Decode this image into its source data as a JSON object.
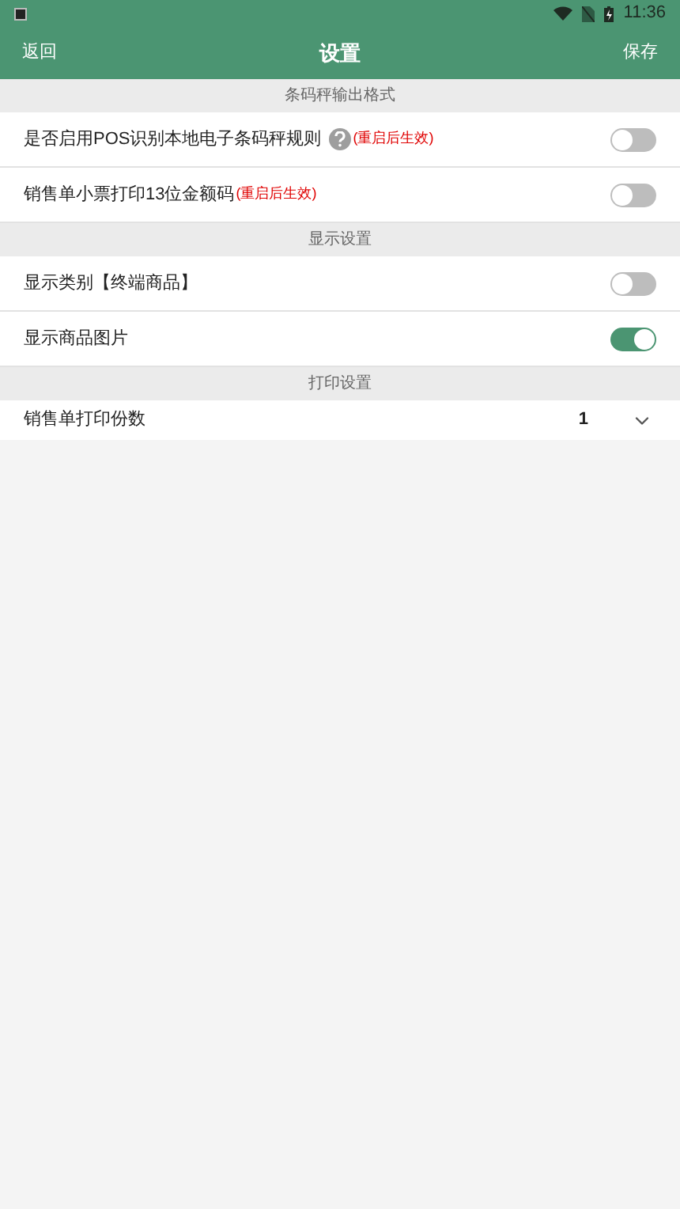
{
  "status_bar": {
    "time": "11:36"
  },
  "header": {
    "back": "返回",
    "title": "设置",
    "save": "保存"
  },
  "sections": [
    {
      "title": "条码秤输出格式",
      "items": [
        {
          "kind": "toggle",
          "label": "是否启用POS识别本地电子条码秤规则",
          "help": true,
          "note": "(重启后生效)",
          "on": false
        },
        {
          "kind": "toggle",
          "label": "销售单小票打印13位金额码",
          "help": false,
          "note": "(重启后生效)",
          "on": false
        }
      ]
    },
    {
      "title": "显示设置",
      "items": [
        {
          "kind": "toggle",
          "label": "显示类别【终端商品】",
          "help": false,
          "on": false
        },
        {
          "kind": "toggle",
          "label": "显示商品图片",
          "help": false,
          "on": true
        }
      ]
    },
    {
      "title": "打印设置",
      "items": [
        {
          "kind": "select",
          "label": "销售单打印份数",
          "value": "1"
        }
      ]
    }
  ]
}
